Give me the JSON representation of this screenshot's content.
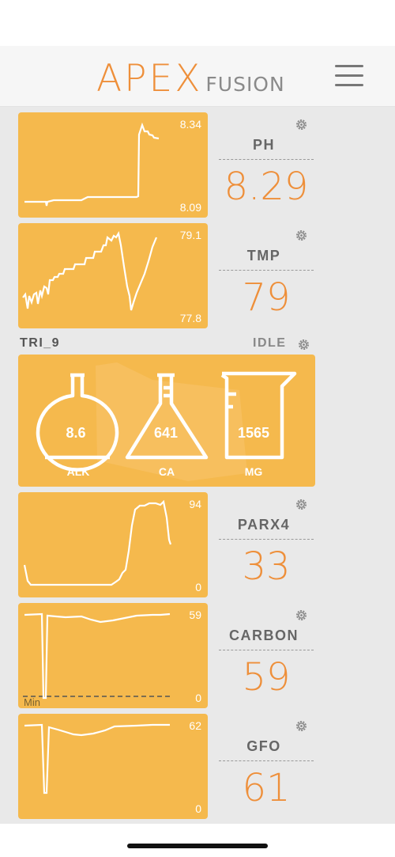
{
  "brand": {
    "apex": "APEX",
    "fusion": "FUSION",
    "accent": "#ee8f3a",
    "card_color": "#f5b94d"
  },
  "header": {
    "menu_icon": "hamburger-menu-icon"
  },
  "probes": [
    {
      "label": "PH",
      "value": "8.29",
      "max": "8.34",
      "min": "8.09"
    },
    {
      "label": "TMP",
      "value": "79",
      "max": "79.1",
      "min": "77.8"
    },
    {
      "label": "PARX4",
      "value": "33",
      "max": "94",
      "min": "0"
    },
    {
      "label": "CARBON",
      "value": "59",
      "max": "59",
      "min": "0",
      "note": "Min"
    },
    {
      "label": "GFO",
      "value": "61",
      "max": "62",
      "min": "0"
    }
  ],
  "trident": {
    "name": "TRI_9",
    "status": "IDLE",
    "tests": [
      {
        "name": "ALK",
        "value": "8.6"
      },
      {
        "name": "CA",
        "value": "641"
      },
      {
        "name": "MG",
        "value": "1565"
      }
    ]
  }
}
